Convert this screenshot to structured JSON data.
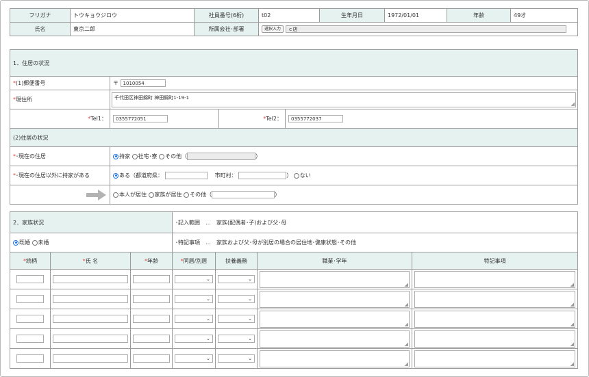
{
  "header": {
    "furigana_label": "フリガナ",
    "furigana_value": "トウキョウジロウ",
    "employee_no_label": "社員番号(6桁)",
    "employee_no_value": "t02",
    "birth_label": "生年月日",
    "birth_value": "1972/01/01",
    "age_label": "年齢",
    "age_value": "49才",
    "name_label": "氏名",
    "name_value": "東京二郎",
    "company_label": "所属会社･部署",
    "select_button": "選択入力",
    "company_value": "ｃ店"
  },
  "residence": {
    "section_title": "1．住居の状況",
    "postal_label": "(1)郵便番号",
    "postal_mark": "〒",
    "postal_value": "1010054",
    "address_label": "現住所",
    "address_value": "千代田区神田錦町 神田錦町1-19-1",
    "tel1_label": "Tel1：",
    "tel1_value": "0355772051",
    "tel2_label": "Tel2：",
    "tel2_value": "0355772037",
    "subsection_title": "(2)住居の状況",
    "current_label": "･現在の住居",
    "current_opt1": "持家",
    "current_opt2": "社宅･寮",
    "current_opt3": "その他（",
    "close_paren": "）",
    "other_home_label": "･現在の住居以外に持家がある",
    "other_opt_yes": "ある（都道府県：",
    "city_label": "市町村：",
    "other_opt_no": "ない",
    "occ_opt1": "本人が居住",
    "occ_opt2": "家族が居住",
    "occ_opt3": "その他（"
  },
  "family": {
    "section_title": "2．家族状況",
    "scope_label": "･記入範囲　…　家族(配偶者･子)および父･母",
    "married_opt": "既婚",
    "single_opt": "未婚",
    "note_label": "･特記事項　…　家族および父･母が別居の場合の居住地･健康状態･その他",
    "col_relation": "続柄",
    "col_name": "氏 名",
    "col_age": "年齢",
    "col_living": "同居/別居",
    "col_support": "扶養義務",
    "col_job": "職業･学年",
    "col_notes": "特記事項",
    "rows": [
      1,
      2,
      3,
      4,
      5
    ]
  },
  "icons": {
    "arrow": "right-arrow-icon",
    "chevron": "chevron-down-icon",
    "resize": "resize-grip-icon"
  },
  "colors": {
    "label_bg": "#e6f2ef",
    "required": "#e0453c",
    "radio": "#1a73e8"
  }
}
